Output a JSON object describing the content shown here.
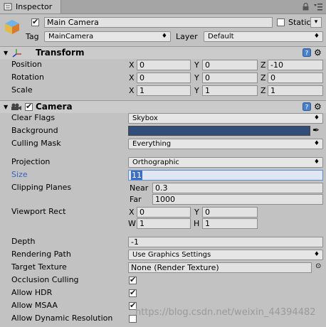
{
  "tab": {
    "label": "Inspector"
  },
  "gameobject": {
    "name": "Main Camera",
    "static_label": "Static",
    "tag_label": "Tag",
    "tag_value": "MainCamera",
    "layer_label": "Layer",
    "layer_value": "Default"
  },
  "transform": {
    "title": "Transform",
    "position": {
      "label": "Position",
      "x": "0",
      "y": "0",
      "z": "-10"
    },
    "rotation": {
      "label": "Rotation",
      "x": "0",
      "y": "0",
      "z": "0"
    },
    "scale": {
      "label": "Scale",
      "x": "1",
      "y": "1",
      "z": "1"
    }
  },
  "axes": {
    "x": "X",
    "y": "Y",
    "z": "Z",
    "w": "W",
    "h": "H"
  },
  "camera": {
    "title": "Camera",
    "clear_flags": {
      "label": "Clear Flags",
      "value": "Skybox"
    },
    "background": {
      "label": "Background",
      "color": "#314d79"
    },
    "culling_mask": {
      "label": "Culling Mask",
      "value": "Everything"
    },
    "projection": {
      "label": "Projection",
      "value": "Orthographic"
    },
    "size": {
      "label": "Size",
      "value": "11"
    },
    "clipping": {
      "label": "Clipping Planes",
      "near_label": "Near",
      "near": "0.3",
      "far_label": "Far",
      "far": "1000"
    },
    "viewport": {
      "label": "Viewport Rect",
      "x": "0",
      "y": "0",
      "w": "1",
      "h": "1"
    },
    "depth": {
      "label": "Depth",
      "value": "-1"
    },
    "rendering_path": {
      "label": "Rendering Path",
      "value": "Use Graphics Settings"
    },
    "target_texture": {
      "label": "Target Texture",
      "value": "None (Render Texture)"
    },
    "occlusion_culling": {
      "label": "Occlusion Culling",
      "checked": true
    },
    "allow_hdr": {
      "label": "Allow HDR",
      "checked": true
    },
    "allow_msaa": {
      "label": "Allow MSAA",
      "checked": true
    },
    "allow_dynamic_resolution": {
      "label": "Allow Dynamic Resolution",
      "checked": false
    }
  },
  "watermark": "https://blog.csdn.net/weixin_44394482",
  "colors": {
    "accent": "#3465c0",
    "panel": "#c2c2c2",
    "header": "#cbcbcb"
  }
}
